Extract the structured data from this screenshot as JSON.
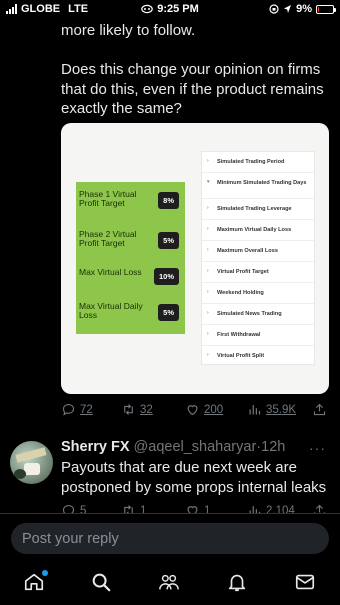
{
  "status_bar": {
    "carrier": "GLOBE",
    "network": "LTE",
    "time": "9:25 PM",
    "battery": "9%",
    "battery_level": 0.09,
    "battery_color": "#ff3b30"
  },
  "tweet": {
    "text_top": "more likely to follow.",
    "text_question": "Does this change your opinion on firms that do this, even if the product remains exactly the same?",
    "media": {
      "green_rows": [
        {
          "label": "Phase 1 Virtual Profit Target",
          "value": "8%"
        },
        {
          "label": "Phase 2 Virtual Profit Target",
          "value": "5%"
        },
        {
          "label": "Max Virtual Loss",
          "value": "10%"
        },
        {
          "label": "Max Virtual Daily Loss",
          "value": "5%"
        }
      ],
      "menu_items": [
        {
          "label": "Simulated Trading Period",
          "arrow": "›"
        },
        {
          "label": "Minimum Simulated Trading Days",
          "arrow": "▾"
        },
        {
          "label": "Simulated Trading Leverage",
          "arrow": "›"
        },
        {
          "label": "Maximum Virtual Daily Loss",
          "arrow": "›"
        },
        {
          "label": "Maximum Overall Loss",
          "arrow": "›"
        },
        {
          "label": "Virtual Profit Target",
          "arrow": "›"
        },
        {
          "label": "Weekend Holding",
          "arrow": "›"
        },
        {
          "label": "Simulated News Trading",
          "arrow": "›"
        },
        {
          "label": "First Withdrawal",
          "arrow": "›"
        },
        {
          "label": "Virtual Profit Split",
          "arrow": "›"
        }
      ]
    },
    "actions": {
      "replies": "72",
      "reposts": "32",
      "likes": "200",
      "views": "35.9K"
    }
  },
  "reply_tweet": {
    "name": "Sherry FX",
    "handle": "@aqeel_shaharyar",
    "time": "12h",
    "text": "Payouts that are due next week are postponed by some props internal leaks",
    "actions": {
      "replies": "5",
      "reposts": "1",
      "likes": "1",
      "views": "2,104"
    }
  },
  "composer": {
    "placeholder": "Post your reply"
  },
  "nav": {
    "items": [
      "home-icon",
      "search-icon",
      "communities-icon",
      "notifications-icon",
      "messages-icon"
    ],
    "accent": "#1d9bf0"
  }
}
